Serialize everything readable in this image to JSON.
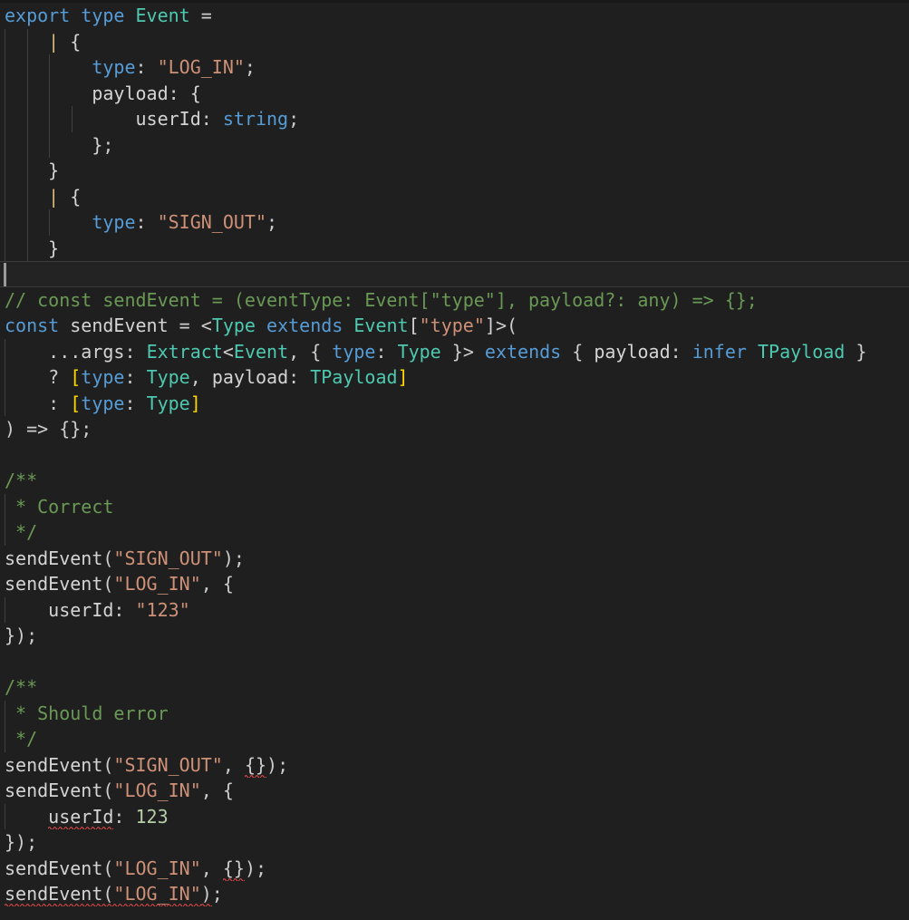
{
  "editor": {
    "app": "code-editor",
    "language": "typescript",
    "theme": "dark-modern",
    "background": "#1f1f1f",
    "foreground": "#cccccc",
    "current_line_background": "#232323",
    "current_line_border": "#3a3a3a",
    "indent_guide_color": "#404040",
    "error_squiggle_color": "#f14c4c",
    "font_size_px": 20,
    "line_height_px": 28.5
  },
  "colors": {
    "keyword": "#569cd6",
    "type": "#4ec9b0",
    "string": "#ce9178",
    "number": "#b5cea8",
    "comment": "#6a9955",
    "property": "#9cdcfe",
    "bracket_yellow": "#ffd700",
    "union_pipe": "#d7ba7d",
    "plain": "#cccccc"
  },
  "lines": [
    {
      "n": 1,
      "text": "export type Event =",
      "guides": [],
      "tokens": [
        {
          "t": "export",
          "c": "kw"
        },
        {
          "t": " ",
          "c": "plain"
        },
        {
          "t": "type",
          "c": "kw"
        },
        {
          "t": " ",
          "c": "plain"
        },
        {
          "t": "Event",
          "c": "typ"
        },
        {
          "t": " ",
          "c": "plain"
        },
        {
          "t": "=",
          "c": "plain"
        }
      ]
    },
    {
      "n": 2,
      "text": "    | {",
      "guides": [
        0,
        2
      ],
      "tokens": [
        {
          "t": "    ",
          "c": "plain"
        },
        {
          "t": "|",
          "c": "pipe"
        },
        {
          "t": " ",
          "c": "plain"
        },
        {
          "t": "{",
          "c": "white"
        }
      ]
    },
    {
      "n": 3,
      "text": "        type: \"LOG_IN\";",
      "guides": [
        0,
        2,
        4
      ],
      "tokens": [
        {
          "t": "        ",
          "c": "plain"
        },
        {
          "t": "type",
          "c": "propblu"
        },
        {
          "t": ": ",
          "c": "plain"
        },
        {
          "t": "\"LOG_IN\"",
          "c": "str"
        },
        {
          "t": ";",
          "c": "plain"
        }
      ]
    },
    {
      "n": 4,
      "text": "        payload: {",
      "guides": [
        0,
        2,
        4
      ],
      "tokens": [
        {
          "t": "        ",
          "c": "plain"
        },
        {
          "t": "payload",
          "c": "white"
        },
        {
          "t": ": ",
          "c": "plain"
        },
        {
          "t": "{",
          "c": "white"
        }
      ]
    },
    {
      "n": 5,
      "text": "            userId: string;",
      "guides": [
        0,
        2,
        4,
        6
      ],
      "tokens": [
        {
          "t": "            ",
          "c": "plain"
        },
        {
          "t": "userId",
          "c": "white"
        },
        {
          "t": ": ",
          "c": "plain"
        },
        {
          "t": "string",
          "c": "propblu"
        },
        {
          "t": ";",
          "c": "plain"
        }
      ]
    },
    {
      "n": 6,
      "text": "        };",
      "guides": [
        0,
        2,
        4
      ],
      "tokens": [
        {
          "t": "        ",
          "c": "plain"
        },
        {
          "t": "}",
          "c": "white"
        },
        {
          "t": ";",
          "c": "plain"
        }
      ]
    },
    {
      "n": 7,
      "text": "    }",
      "guides": [
        0,
        2
      ],
      "tokens": [
        {
          "t": "    ",
          "c": "plain"
        },
        {
          "t": "}",
          "c": "white"
        }
      ]
    },
    {
      "n": 8,
      "text": "    | {",
      "guides": [
        0,
        2
      ],
      "tokens": [
        {
          "t": "    ",
          "c": "plain"
        },
        {
          "t": "|",
          "c": "pipe"
        },
        {
          "t": " ",
          "c": "plain"
        },
        {
          "t": "{",
          "c": "white"
        }
      ]
    },
    {
      "n": 9,
      "text": "        type: \"SIGN_OUT\";",
      "guides": [
        0,
        2,
        4
      ],
      "tokens": [
        {
          "t": "        ",
          "c": "plain"
        },
        {
          "t": "type",
          "c": "propblu"
        },
        {
          "t": ": ",
          "c": "plain"
        },
        {
          "t": "\"SIGN_OUT\"",
          "c": "str"
        },
        {
          "t": ";",
          "c": "plain"
        }
      ]
    },
    {
      "n": 10,
      "text": "    }",
      "guides": [
        0,
        2
      ],
      "tokens": [
        {
          "t": "    ",
          "c": "plain"
        },
        {
          "t": "}",
          "c": "white"
        }
      ]
    },
    {
      "n": 11,
      "text": "",
      "current": true,
      "cursor": true,
      "guides": [],
      "tokens": []
    },
    {
      "n": 12,
      "text": "// const sendEvent = (eventType: Event[\"type\"], payload?: any) => {};",
      "guides": [],
      "tokens": [
        {
          "t": "// const sendEvent = (eventType: Event[\"type\"], payload?: any) => {};",
          "c": "cmt"
        }
      ]
    },
    {
      "n": 13,
      "text": "const sendEvent = <Type extends Event[\"type\"]>(",
      "guides": [],
      "tokens": [
        {
          "t": "const",
          "c": "kw"
        },
        {
          "t": " ",
          "c": "plain"
        },
        {
          "t": "sendEvent",
          "c": "white"
        },
        {
          "t": " = <",
          "c": "plain"
        },
        {
          "t": "Type",
          "c": "typ"
        },
        {
          "t": " ",
          "c": "plain"
        },
        {
          "t": "extends",
          "c": "kw"
        },
        {
          "t": " ",
          "c": "plain"
        },
        {
          "t": "Event",
          "c": "typ"
        },
        {
          "t": "[",
          "c": "white"
        },
        {
          "t": "\"type\"",
          "c": "str"
        },
        {
          "t": "]",
          "c": "white"
        },
        {
          "t": ">(",
          "c": "plain"
        }
      ]
    },
    {
      "n": 14,
      "text": "    ...args: Extract<Event, { type: Type }> extends { payload: infer TPayload }",
      "guides": [
        0
      ],
      "tokens": [
        {
          "t": "    ...",
          "c": "plain"
        },
        {
          "t": "args",
          "c": "white"
        },
        {
          "t": ": ",
          "c": "plain"
        },
        {
          "t": "Extract",
          "c": "typ"
        },
        {
          "t": "<",
          "c": "plain"
        },
        {
          "t": "Event",
          "c": "typ"
        },
        {
          "t": ", { ",
          "c": "plain"
        },
        {
          "t": "type",
          "c": "propblu"
        },
        {
          "t": ": ",
          "c": "plain"
        },
        {
          "t": "Type",
          "c": "typ"
        },
        {
          "t": " }> ",
          "c": "plain"
        },
        {
          "t": "extends",
          "c": "kw"
        },
        {
          "t": " { ",
          "c": "plain"
        },
        {
          "t": "payload",
          "c": "white"
        },
        {
          "t": ": ",
          "c": "plain"
        },
        {
          "t": "infer",
          "c": "kw"
        },
        {
          "t": " ",
          "c": "plain"
        },
        {
          "t": "TPayload",
          "c": "typ"
        },
        {
          "t": " }",
          "c": "plain"
        }
      ]
    },
    {
      "n": 15,
      "text": "    ? [type: Type, payload: TPayload]",
      "guides": [
        0
      ],
      "tokens": [
        {
          "t": "    ? ",
          "c": "plain"
        },
        {
          "t": "[",
          "c": "brk1"
        },
        {
          "t": "type",
          "c": "propblu"
        },
        {
          "t": ": ",
          "c": "plain"
        },
        {
          "t": "Type",
          "c": "typ"
        },
        {
          "t": ", ",
          "c": "plain"
        },
        {
          "t": "payload",
          "c": "white"
        },
        {
          "t": ": ",
          "c": "plain"
        },
        {
          "t": "TPayload",
          "c": "typ"
        },
        {
          "t": "]",
          "c": "brk1"
        }
      ]
    },
    {
      "n": 16,
      "text": "    : [type: Type]",
      "guides": [
        0
      ],
      "tokens": [
        {
          "t": "    : ",
          "c": "plain"
        },
        {
          "t": "[",
          "c": "brk1"
        },
        {
          "t": "type",
          "c": "propblu"
        },
        {
          "t": ": ",
          "c": "plain"
        },
        {
          "t": "Type",
          "c": "typ"
        },
        {
          "t": "]",
          "c": "brk1"
        }
      ]
    },
    {
      "n": 17,
      "text": ") => {};",
      "guides": [],
      "tokens": [
        {
          "t": ") => {};",
          "c": "plain"
        }
      ]
    },
    {
      "n": 18,
      "text": "",
      "guides": [],
      "tokens": []
    },
    {
      "n": 19,
      "text": "/**",
      "guides": [],
      "tokens": [
        {
          "t": "/**",
          "c": "cmt"
        }
      ]
    },
    {
      "n": 20,
      "text": " * Correct",
      "guides": [
        0
      ],
      "tokens": [
        {
          "t": " * Correct",
          "c": "cmt"
        }
      ]
    },
    {
      "n": 21,
      "text": " */",
      "guides": [
        0
      ],
      "tokens": [
        {
          "t": " */",
          "c": "cmt"
        }
      ]
    },
    {
      "n": 22,
      "text": "sendEvent(\"SIGN_OUT\");",
      "guides": [],
      "tokens": [
        {
          "t": "sendEvent",
          "c": "white"
        },
        {
          "t": "(",
          "c": "plain"
        },
        {
          "t": "\"SIGN_OUT\"",
          "c": "str"
        },
        {
          "t": ");",
          "c": "plain"
        }
      ]
    },
    {
      "n": 23,
      "text": "sendEvent(\"LOG_IN\", {",
      "guides": [],
      "tokens": [
        {
          "t": "sendEvent",
          "c": "white"
        },
        {
          "t": "(",
          "c": "plain"
        },
        {
          "t": "\"LOG_IN\"",
          "c": "str"
        },
        {
          "t": ", {",
          "c": "plain"
        }
      ]
    },
    {
      "n": 24,
      "text": "    userId: \"123\"",
      "guides": [
        0
      ],
      "tokens": [
        {
          "t": "    ",
          "c": "plain"
        },
        {
          "t": "userId",
          "c": "white"
        },
        {
          "t": ": ",
          "c": "plain"
        },
        {
          "t": "\"123\"",
          "c": "str"
        }
      ]
    },
    {
      "n": 25,
      "text": "});",
      "guides": [],
      "tokens": [
        {
          "t": "});",
          "c": "plain"
        }
      ]
    },
    {
      "n": 26,
      "text": "",
      "guides": [],
      "tokens": []
    },
    {
      "n": 27,
      "text": "/**",
      "guides": [],
      "tokens": [
        {
          "t": "/**",
          "c": "cmt"
        }
      ]
    },
    {
      "n": 28,
      "text": " * Should error",
      "guides": [
        0
      ],
      "tokens": [
        {
          "t": " * Should error",
          "c": "cmt"
        }
      ]
    },
    {
      "n": 29,
      "text": " */",
      "guides": [
        0
      ],
      "tokens": [
        {
          "t": " */",
          "c": "cmt"
        }
      ]
    },
    {
      "n": 30,
      "text": "sendEvent(\"SIGN_OUT\", {});",
      "guides": [],
      "tokens": [
        {
          "t": "sendEvent",
          "c": "white"
        },
        {
          "t": "(",
          "c": "plain"
        },
        {
          "t": "\"SIGN_OUT\"",
          "c": "str"
        },
        {
          "t": ", ",
          "c": "plain"
        },
        {
          "t": "{}",
          "c": "plain",
          "err": true
        },
        {
          "t": ");",
          "c": "plain"
        }
      ]
    },
    {
      "n": 31,
      "text": "sendEvent(\"LOG_IN\", {",
      "guides": [],
      "tokens": [
        {
          "t": "sendEvent",
          "c": "white"
        },
        {
          "t": "(",
          "c": "plain"
        },
        {
          "t": "\"LOG_IN\"",
          "c": "str"
        },
        {
          "t": ", {",
          "c": "plain"
        }
      ]
    },
    {
      "n": 32,
      "text": "    userId: 123",
      "guides": [
        0
      ],
      "tokens": [
        {
          "t": "    ",
          "c": "plain"
        },
        {
          "t": "userId",
          "c": "white",
          "err": true
        },
        {
          "t": ": ",
          "c": "plain"
        },
        {
          "t": "123",
          "c": "num"
        }
      ]
    },
    {
      "n": 33,
      "text": "});",
      "guides": [],
      "tokens": [
        {
          "t": "});",
          "c": "plain"
        }
      ]
    },
    {
      "n": 34,
      "text": "sendEvent(\"LOG_IN\", {});",
      "guides": [],
      "tokens": [
        {
          "t": "sendEvent",
          "c": "white"
        },
        {
          "t": "(",
          "c": "plain"
        },
        {
          "t": "\"LOG_IN\"",
          "c": "str"
        },
        {
          "t": ", ",
          "c": "plain"
        },
        {
          "t": "{}",
          "c": "plain",
          "err": true
        },
        {
          "t": ");",
          "c": "plain"
        }
      ]
    },
    {
      "n": 35,
      "text": "sendEvent(\"LOG_IN\");",
      "guides": [],
      "tokens": [
        {
          "t": "sendEvent",
          "c": "white",
          "err": true
        },
        {
          "t": "(",
          "c": "plain",
          "err": true
        },
        {
          "t": "\"LOG_IN\"",
          "c": "str",
          "err": true
        },
        {
          "t": ")",
          "c": "plain",
          "err": true
        },
        {
          "t": ";",
          "c": "plain"
        }
      ]
    }
  ]
}
